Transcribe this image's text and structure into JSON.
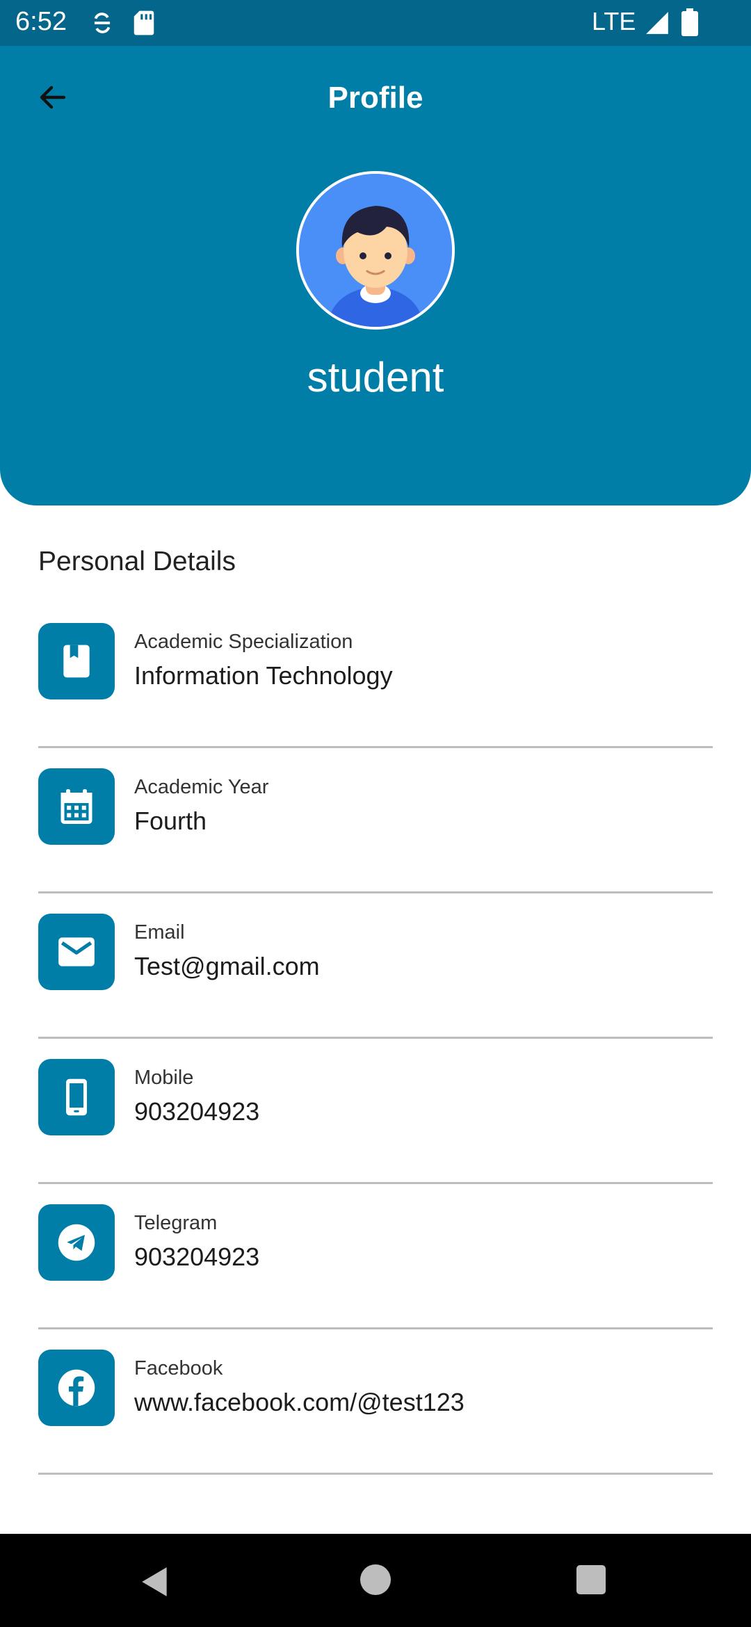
{
  "status_bar": {
    "time": "6:52",
    "network": "LTE",
    "icons": [
      "sync-icon",
      "sd-card-icon",
      "signal-icon",
      "battery-icon"
    ]
  },
  "header": {
    "title": "Profile",
    "back_icon": "arrow-back-icon",
    "user_name": "student",
    "background_color": "#007ea8"
  },
  "details": {
    "section_title": "Personal Details",
    "items": [
      {
        "icon": "book-icon",
        "label": "Academic Specialization",
        "value": "Information Technology"
      },
      {
        "icon": "calendar-icon",
        "label": "Academic Year",
        "value": "Fourth"
      },
      {
        "icon": "email-icon",
        "label": "Email",
        "value": "Test@gmail.com"
      },
      {
        "icon": "phone-icon",
        "label": "Mobile",
        "value": "903204923"
      },
      {
        "icon": "telegram-icon",
        "label": "Telegram",
        "value": "903204923"
      },
      {
        "icon": "facebook-icon",
        "label": "Facebook",
        "value": "www.facebook.com/@test123"
      }
    ]
  },
  "nav_bar": {
    "buttons": [
      "nav-back-icon",
      "nav-home-icon",
      "nav-recents-icon"
    ]
  }
}
